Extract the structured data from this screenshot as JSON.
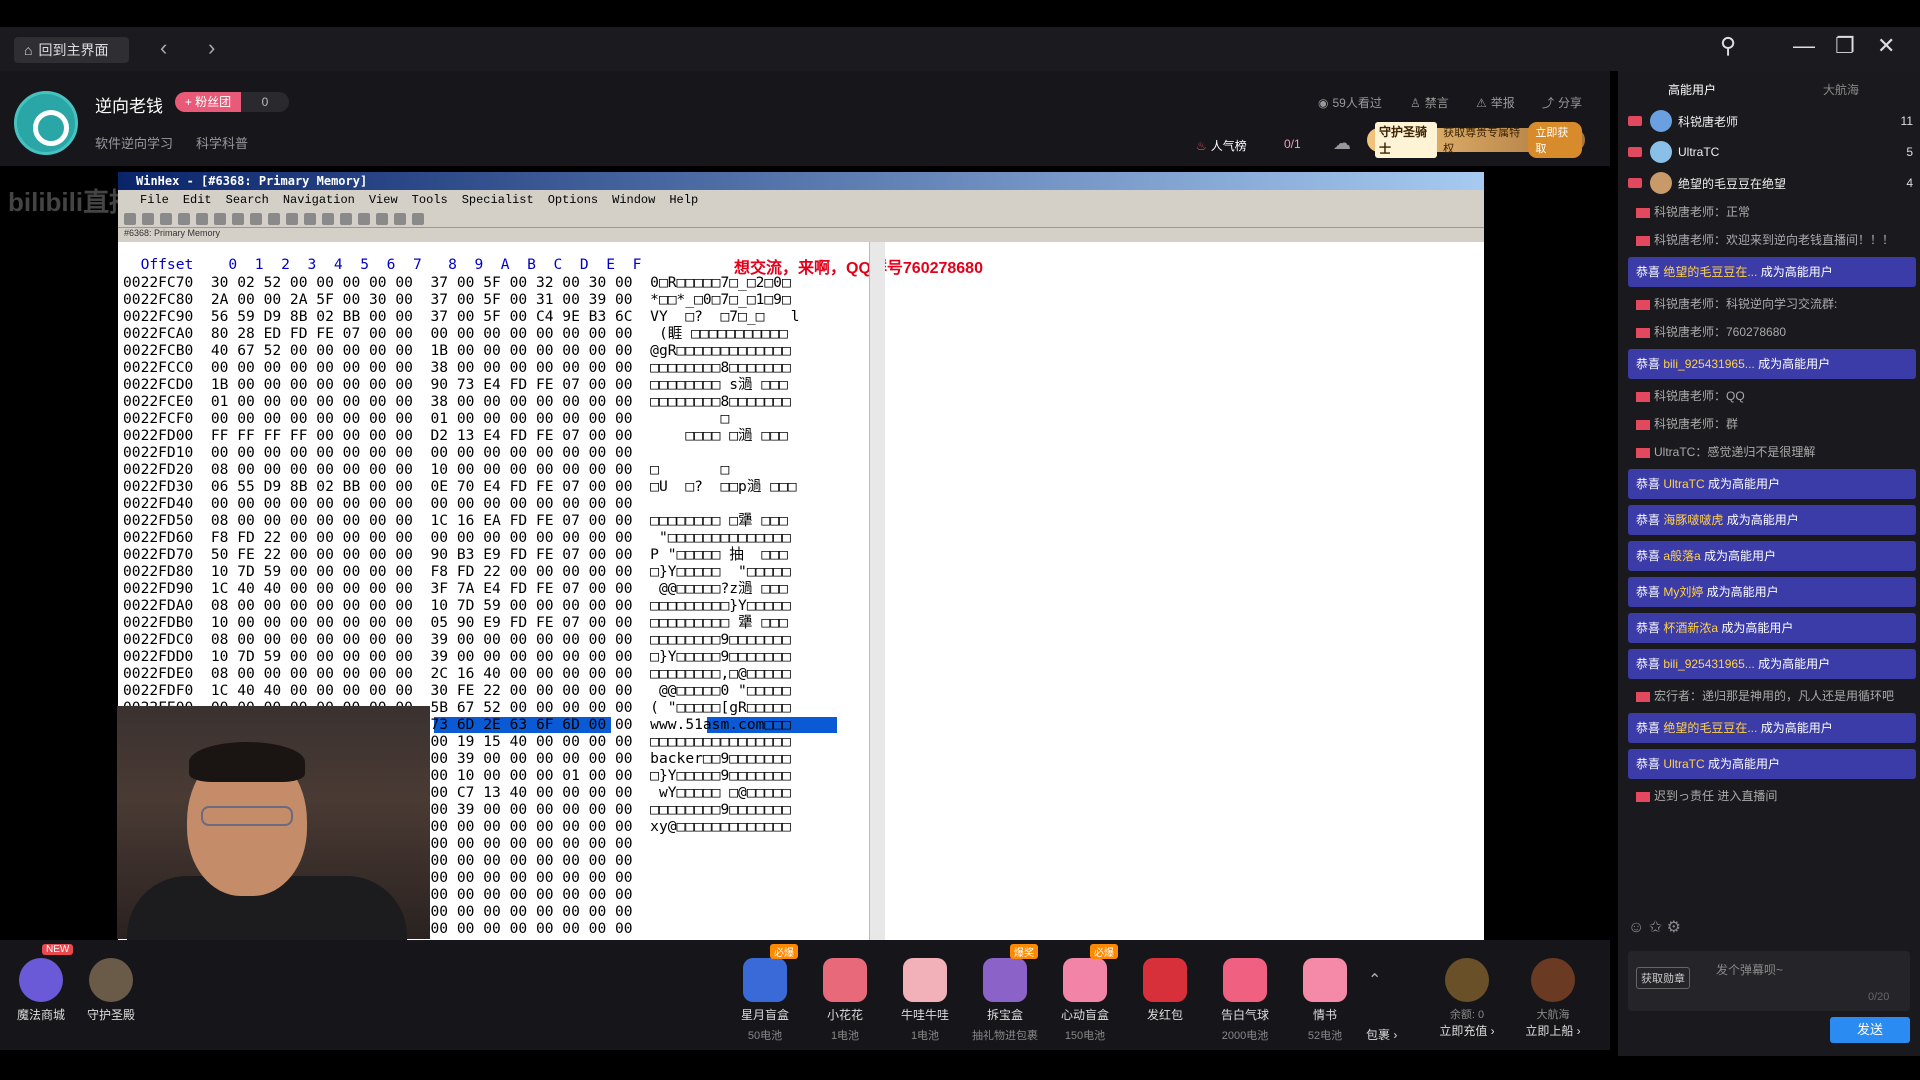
{
  "topbar": {
    "home_label": "回到主界面",
    "back": "‹",
    "forward": "›"
  },
  "header": {
    "streamer": "逆向老钱",
    "fan_badge": "+ 粉丝团",
    "fan_count": "0",
    "tags": [
      "软件逆向学习",
      "科学科普"
    ],
    "viewers": "59人看过",
    "ban": "禁言",
    "report": "举报",
    "share": "分享",
    "popularity": "人气榜",
    "rank": "0/1",
    "guard_title": "守护圣骑士",
    "guard_desc": "获取尊贵专属特权",
    "guard_btn": "立即获取"
  },
  "winhex": {
    "title": "WinHex - [#6368: Primary Memory]",
    "menu": [
      "File",
      "Edit",
      "Search",
      "Navigation",
      "View",
      "Tools",
      "Specialist",
      "Options",
      "Window",
      "Help"
    ],
    "tab": "#6368: Primary Memory",
    "header": "  Offset    0  1  2  3  4  5  6  7   8  9  A  B  C  D  E  F",
    "qq_text": "想交流，来啊，QQ群号760278680",
    "rows": [
      "0022FC70  30 02 52 00 00 00 00 00  37 00 5F 00 32 00 30 00  0□R□□□□□7□_□2□0□",
      "0022FC80  2A 00 00 2A 5F 00 30 00  37 00 5F 00 31 00 39 00  *□□*_□0□7□_□1□9□",
      "0022FC90  56 59 D9 8B 02 BB 00 00  37 00 5F 00 C4 9E B3 6C  VY  □?  □7□_□   l",
      "0022FCA0  80 28 ED FD FE 07 00 00  00 00 00 00 00 00 00 00   (睚 □□□□□□□□□□□",
      "0022FCB0  40 67 52 00 00 00 00 00  1B 00 00 00 00 00 00 00  @gR□□□□□□□□□□□□□",
      "0022FCC0  00 00 00 00 00 00 00 00  38 00 00 00 00 00 00 00  □□□□□□□□8□□□□□□□",
      "0022FCD0  1B 00 00 00 00 00 00 00  90 73 E4 FD FE 07 00 00  □□□□□□□□ s濄 □□□",
      "0022FCE0  01 00 00 00 00 00 00 00  38 00 00 00 00 00 00 00  □□□□□□□□8□□□□□□□",
      "0022FCF0  00 00 00 00 00 00 00 00  01 00 00 00 00 00 00 00          □       ",
      "0022FD00  FF FF FF FF 00 00 00 00  D2 13 E4 FD FE 07 00 00      □□□□ □濄 □□□",
      "0022FD10  00 00 00 00 00 00 00 00  00 00 00 00 00 00 00 00                  ",
      "0022FD20  08 00 00 00 00 00 00 00  10 00 00 00 00 00 00 00  □       □       ",
      "0022FD30  06 55 D9 8B 02 BB 00 00  0E 70 E4 FD FE 07 00 00  □U  □?  □□p濄 □□□",
      "0022FD40  00 00 00 00 00 00 00 00  00 00 00 00 00 00 00 00                  ",
      "0022FD50  08 00 00 00 00 00 00 00  1C 16 EA FD FE 07 00 00  □□□□□□□□ □犟 □□□",
      "0022FD60  F8 FD 22 00 00 00 00 00  00 00 00 00 00 00 00 00   \"□□□□□□□□□□□□□□",
      "0022FD70  50 FE 22 00 00 00 00 00  90 B3 E9 FD FE 07 00 00  P \"□□□□□ 抽  □□□",
      "0022FD80  10 7D 59 00 00 00 00 00  F8 FD 22 00 00 00 00 00  □}Y□□□□□  \"□□□□□",
      "0022FD90  1C 40 40 00 00 00 00 00  3F 7A E4 FD FE 07 00 00   @@□□□□□?z濄 □□□",
      "0022FDA0  08 00 00 00 00 00 00 00  10 7D 59 00 00 00 00 00  □□□□□□□□□}Y□□□□□",
      "0022FDB0  10 00 00 00 00 00 00 00  05 90 E9 FD FE 07 00 00  □□□□□□□□□ 犟 □□□",
      "0022FDC0  08 00 00 00 00 00 00 00  39 00 00 00 00 00 00 00  □□□□□□□□9□□□□□□□",
      "0022FDD0  10 7D 59 00 00 00 00 00  39 00 00 00 00 00 00 00  □}Y□□□□□9□□□□□□□",
      "0022FDE0  08 00 00 00 00 00 00 00  2C 16 40 00 00 00 00 00  □□□□□□□□,□@□□□□□",
      "0022FDF0  1C 40 40 00 00 00 00 00  30 FE 22 00 00 00 00 00   @@□□□□□0 \"□□□□□",
      "0022FE00  00 00 00 00 00 00 00 00  5B 67 52 00 00 00 00 00  ( \"□□□□□[gR□□□□□",
      "                                   73 6D 2E 63 6F 6D 00 00  www.51asm.com□□□",
      "                                   00 19 15 40 00 00 00 00  □□□□□□□□□□□□□□□□",
      "                                   00 39 00 00 00 00 00 00  backer□□9□□□□□□□",
      "                                   00 10 00 00 00 01 00 00  □}Y□□□□□9□□□□□□□",
      "                                   00 C7 13 40 00 00 00 00   wY□□□□□ □@□□□□□",
      "                                   00 39 00 00 00 00 00 00  □□□□□□□□9□□□□□□□",
      "                                   00 00 00 00 00 00 00 00  xy@□□□□□□□□□□□□□",
      "                                   00 00 00 00 00 00 00 00                  ",
      "                                   00 00 00 00 00 00 00 00                  ",
      "                                   00 00 00 00 00 00 00 00                  ",
      "                                   00 00 00 00 00 00 00 00                  ",
      "                                   00 00 00 00 00 00 00 00                  ",
      "                                   00 00 00 00 00 00 00 00                  "
    ]
  },
  "gifts_left": [
    {
      "name": "魔法商城",
      "badge": "NEW"
    },
    {
      "name": "守护圣殿"
    }
  ],
  "gifts": [
    {
      "name": "星月盲盒",
      "price": "50电池",
      "tag": "必爆",
      "color": "#3a6ad8"
    },
    {
      "name": "小花花",
      "price": "1电池",
      "color": "#e86a7a"
    },
    {
      "name": "牛哇牛哇",
      "price": "1电池",
      "color": "#f2b0b8"
    },
    {
      "name": "拆宝盒",
      "price": "抽礼物进包裹",
      "tag": "爆奖",
      "color": "#8a62c8"
    },
    {
      "name": "心动盲盒",
      "price": "150电池",
      "tag": "必爆",
      "color": "#f284a8"
    },
    {
      "name": "发红包",
      "price": "",
      "color": "#d8303a"
    },
    {
      "name": "告白气球",
      "price": "2000电池",
      "color": "#f06080"
    },
    {
      "name": "情书",
      "price": "52电池",
      "color": "#f58aa8"
    }
  ],
  "bag": "包裹 ›",
  "balance": {
    "label": "余额: 0",
    "recharge": "立即充值 ›"
  },
  "ship": {
    "label": "大航海",
    "board": "立即上船 ›"
  },
  "right": {
    "tab_active": "高能用户",
    "tab_other": "大航海",
    "top_users": [
      {
        "name": "科锐唐老师",
        "count": "11"
      },
      {
        "name": "UltraTC",
        "count": "5"
      },
      {
        "name": "绝望的毛豆豆在绝望",
        "count": "4"
      }
    ],
    "chat": [
      {
        "kind": "plain",
        "text": "科锐唐老师：正常"
      },
      {
        "kind": "plain",
        "text": "科锐唐老师：欢迎来到逆向老钱直播间！！！"
      },
      {
        "kind": "congrats",
        "user": "绝望的毛豆豆在...",
        "text": " 成为高能用户"
      },
      {
        "kind": "plain",
        "text": "科锐唐老师：科锐逆向学习交流群:"
      },
      {
        "kind": "plain",
        "text": "科锐唐老师：760278680"
      },
      {
        "kind": "congrats",
        "user": "bili_925431965...",
        "text": " 成为高能用户"
      },
      {
        "kind": "plain",
        "text": "科锐唐老师：QQ"
      },
      {
        "kind": "plain",
        "text": "科锐唐老师：群"
      },
      {
        "kind": "plain",
        "text": "UltraTC：感觉递归不是很理解"
      },
      {
        "kind": "congrats",
        "user": "UltraTC",
        "text": " 成为高能用户"
      },
      {
        "kind": "congrats",
        "user": "海豚啵啵虎",
        "text": " 成为高能用户"
      },
      {
        "kind": "congrats",
        "user": "a般落a",
        "text": " 成为高能用户"
      },
      {
        "kind": "congrats",
        "user": "My刘婷",
        "text": " 成为高能用户"
      },
      {
        "kind": "congrats",
        "user": "杯酒新浓a",
        "text": " 成为高能用户"
      },
      {
        "kind": "congrats",
        "user": "bili_925431965...",
        "text": " 成为高能用户"
      },
      {
        "kind": "plain",
        "text": "宏行者：递归那是神用的，凡人还是用循环吧"
      },
      {
        "kind": "congrats",
        "user": "绝望的毛豆豆在...",
        "text": " 成为高能用户"
      },
      {
        "kind": "congrats",
        "user": "UltraTC",
        "text": " 成为高能用户"
      },
      {
        "kind": "plain",
        "text": "迟到っ责任 进入直播间"
      }
    ],
    "input_placeholder": "发个弹幕呗~",
    "counter": "0/20",
    "send": "发送",
    "medal_btn": "获取勋章"
  }
}
